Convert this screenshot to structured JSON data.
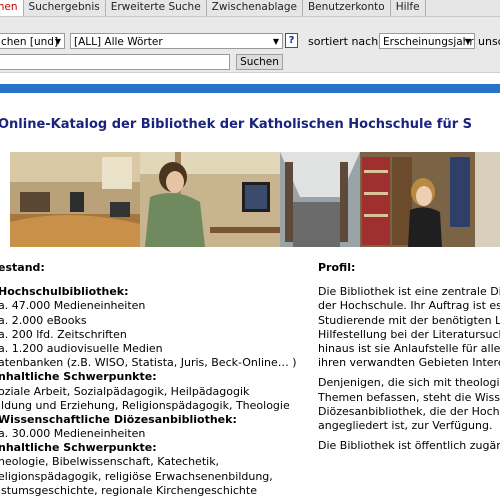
{
  "tabs": [
    {
      "label": "chen",
      "active": true
    },
    {
      "label": "Suchergebnis",
      "active": false
    },
    {
      "label": "Erweiterte Suche",
      "active": false
    },
    {
      "label": "Zwischenablage",
      "active": false
    },
    {
      "label": "Benutzerkonto",
      "active": false
    },
    {
      "label": "Hilfe",
      "active": false
    }
  ],
  "search": {
    "mode_value": "chen [und]",
    "field_value": "[ALL] Alle Wörter",
    "help_label": "?",
    "sort_label": "sortiert nach",
    "sort_value": "Erscheinungsjahr",
    "sort_dir_value": "unsc",
    "query_value": "",
    "submit_label": "Suchen"
  },
  "page_title": "Online-Katalog der Bibliothek der Katholischen Hochschule für S",
  "colors": {
    "accent_bar": "#2b73c9",
    "title": "#1a237e",
    "active_tab": "#cc0000"
  },
  "left": {
    "heading": "estand:",
    "lines": [
      {
        "text": "Hochschulbibliothek:",
        "bold": true
      },
      {
        "text": "a. 47.000 Medieneinheiten",
        "bold": false
      },
      {
        "text": "a. 2.000 eBooks",
        "bold": false
      },
      {
        "text": "a. 200 lfd. Zeitschriften",
        "bold": false
      },
      {
        "text": "a. 1.200 audiovisuelle Medien",
        "bold": false
      },
      {
        "text": "atenbanken (z.B. WISO, Statista, Juris, Beck-Online… )",
        "bold": false
      },
      {
        "text": "nhaltliche Schwerpunkte:",
        "bold": true
      },
      {
        "text": "oziale Arbeit, Sozialpädagogik, Heilpädagogik",
        "bold": false
      },
      {
        "text": "ildung und Erziehung, Religionspädagogik, Theologie",
        "bold": false
      },
      {
        "text": "Wissenschaftliche Diözesanbibliothek:",
        "bold": true
      },
      {
        "text": "a. 30.000 Medieneinheiten",
        "bold": false
      },
      {
        "text": "nhaltliche Schwerpunkte:",
        "bold": true
      },
      {
        "text": "heologie, Bibelwissenschaft, Katechetik,",
        "bold": false
      },
      {
        "text": "eligionspädagogik, religiöse Erwachsenenbildung,",
        "bold": false
      },
      {
        "text": "istumsgeschichte, regionale Kirchengeschichte",
        "bold": false
      }
    ]
  },
  "right": {
    "heading": "Profil:",
    "lines": [
      "Die Bibliothek ist eine zentrale Dien",
      "der Hochschule. Ihr Auftrag ist es,",
      "Studierende mit der benötigten Lite",
      "Hilfestellung bei der Literatursuche",
      "hinaus ist sie Anlaufstelle für alle a",
      "ihren verwandten Gebieten Interess",
      "",
      "Denjenigen, die sich mit theologisc",
      "Themen befassen, steht die Wissen",
      "Diözesanbibliothek, die der Hochsc",
      "angegliedert ist, zur Verfügung.",
      "",
      "Die Bibliothek ist öffentlich zugäng"
    ]
  }
}
